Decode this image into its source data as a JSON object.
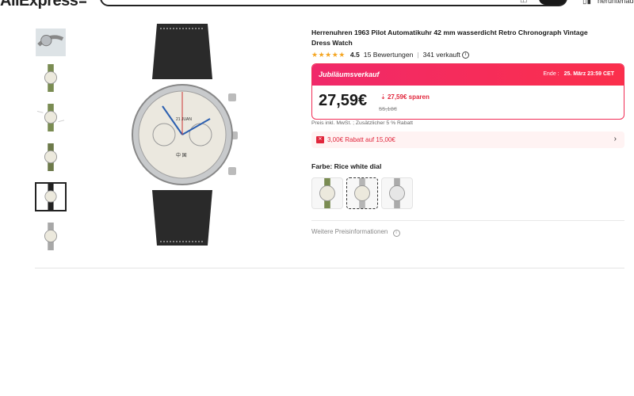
{
  "header": {
    "logo": "AliExpress",
    "download_label": "herunterladen"
  },
  "product": {
    "title": "Herrenuhren 1963 Pilot Automatikuhr 42 mm wasserdicht Retro Chronograph Vintage Dress Watch",
    "rating": "4.5",
    "reviews": "15 Bewertungen",
    "sold": "341 verkauft",
    "stars": "★★★★★"
  },
  "deal": {
    "name": "Jubiläumsverkauf",
    "end_prefix": "Ende :",
    "end_date": "25. März 23:59 CET",
    "price": "27,59€",
    "save": "27,59€ sparen",
    "old_price": "55,18€",
    "accent": "#f12c55"
  },
  "tax_note": "Preis inkl. MwSt. ; Zusätzlicher 5 % Rabatt",
  "coupon": {
    "text": "3,00€ Rabatt auf 15,00€"
  },
  "color": {
    "label": "Farbe:",
    "selected": "Rice white dial"
  },
  "more_info": "Weitere Preisinformationen"
}
